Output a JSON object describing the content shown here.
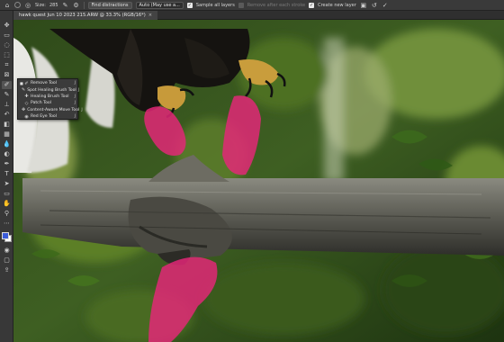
{
  "options_bar": {
    "size_label": "Size:",
    "size_value": "285",
    "find_distractions": "Find distractions",
    "mode_select": "Auto (May use a...",
    "sample_all_layers": "Sample all layers",
    "remove_after_stroke": "Remove after each stroke",
    "create_new_layer": "Create new layer"
  },
  "document": {
    "tab_title": "hawk quest Jun 10 2023 215.ARW @ 33.3% (RGB/16*)",
    "tab_close": "×"
  },
  "flyout": {
    "items": [
      {
        "label": "Remove Tool",
        "shortcut": "J",
        "icon": "remove-tool-icon",
        "selected": true
      },
      {
        "label": "Spot Healing Brush Tool",
        "shortcut": "J",
        "icon": "spot-healing-icon",
        "selected": false
      },
      {
        "label": "Healing Brush Tool",
        "shortcut": "J",
        "icon": "healing-brush-icon",
        "selected": false
      },
      {
        "label": "Patch Tool",
        "shortcut": "J",
        "icon": "patch-tool-icon",
        "selected": false
      },
      {
        "label": "Content-Aware Move Tool",
        "shortcut": "J",
        "icon": "content-aware-move-icon",
        "selected": false
      },
      {
        "label": "Red Eye Tool",
        "shortcut": "J",
        "icon": "red-eye-icon",
        "selected": false
      }
    ]
  },
  "colors": {
    "mask_overlay": "#e8267a",
    "ui_panel": "#383838",
    "foreground_swatch": "#3a5bd9",
    "background_swatch": "#ffffff"
  }
}
